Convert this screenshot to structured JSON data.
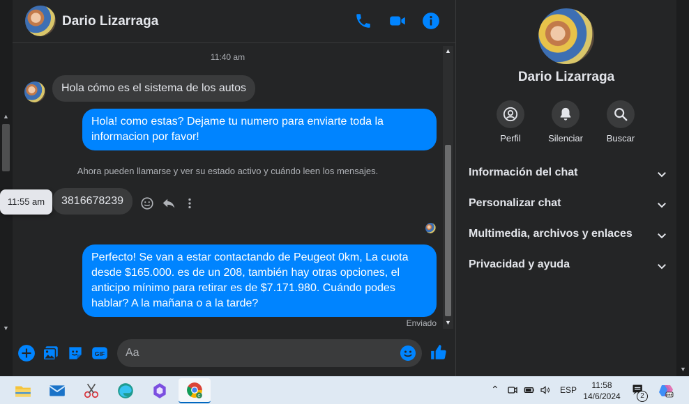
{
  "contact": {
    "name": "Dario Lizarraga"
  },
  "messages": {
    "timestamp_top": "11:40 am",
    "incoming_1": "Hola cómo es el sistema de los autos",
    "outgoing_1": "Hola! como estas? Dejame tu numero para enviarte toda la informacion por favor!",
    "system_notice": "Ahora pueden llamarse y ver su estado activo y cuándo leen los mensajes.",
    "tooltip_time": "11:55 am",
    "incoming_2": "3816678239",
    "outgoing_2": "Perfecto!  Se van a estar contactando de Peugeot 0km, La cuota desde $165.000. es de un 208, también hay otras opciones, el anticipo mínimo para retirar es de $7.171.980. Cuándo podes hablar? A la mañana o a la tarde?",
    "status": "Enviado"
  },
  "composer": {
    "placeholder": "Aa"
  },
  "panel": {
    "name": "Dario Lizarraga",
    "actions": [
      "Perfil",
      "Silenciar",
      "Buscar"
    ],
    "sections": [
      "Información del chat",
      "Personalizar chat",
      "Multimedia, archivos y enlaces",
      "Privacidad y ayuda"
    ]
  },
  "taskbar": {
    "language": "ESP",
    "time": "11:58",
    "date": "14/6/2024",
    "notification_count": "2"
  },
  "colors": {
    "accent": "#0084ff",
    "background": "#242526",
    "bubble_in": "#3a3b3c"
  }
}
